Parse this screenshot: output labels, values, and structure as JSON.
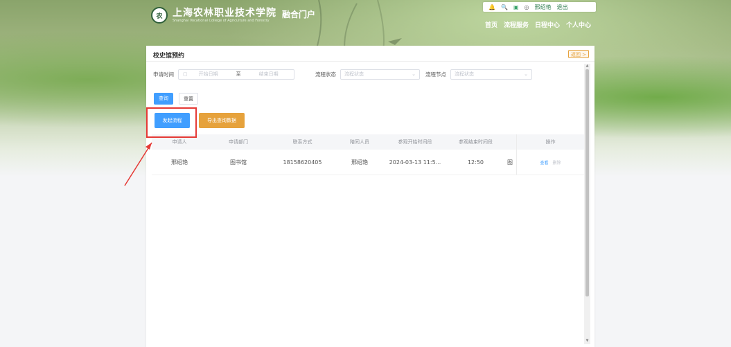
{
  "header": {
    "logo_emblem": "农",
    "school_name_cn": "上海农林职业技术学院",
    "school_name_en": "Shanghai Vocational College of Agriculture and Forestry",
    "portal_name": "融合门户",
    "topbar": {
      "bell_icon": "🔔",
      "search_icon": "🔍",
      "app_icon": "▣",
      "user_icon": "◎",
      "username": "邢绍艳",
      "logout": "退出"
    },
    "nav": [
      "首页",
      "流程服务",
      "日程中心",
      "个人中心"
    ]
  },
  "panel": {
    "title": "校史馆预约",
    "back_label": "返回 >",
    "filters": {
      "apply_time_label": "申请时间",
      "start_placeholder": "开始日期",
      "separator": "至",
      "end_placeholder": "结束日期",
      "status_label": "流程状态",
      "status_placeholder": "流程状态",
      "node_label": "流程节点",
      "node_placeholder": "流程状态"
    },
    "buttons": {
      "query": "查询",
      "reset": "重置",
      "start_flow": "发起流程",
      "export": "导出查询数据"
    },
    "table": {
      "columns": [
        "申请人",
        "申请部门",
        "联系方式",
        "陪同人员",
        "参观开始时间段",
        "参观结束时间段",
        "",
        "操作"
      ],
      "rows": [
        {
          "applicant": "邢绍艳",
          "department": "图书馆",
          "contact": "18158620405",
          "companion": "邢绍艳",
          "start": "2024-03-13 11:5...",
          "end": "12:50",
          "extra": "图",
          "op_view": "查看",
          "op_delete": "删除"
        }
      ]
    }
  }
}
